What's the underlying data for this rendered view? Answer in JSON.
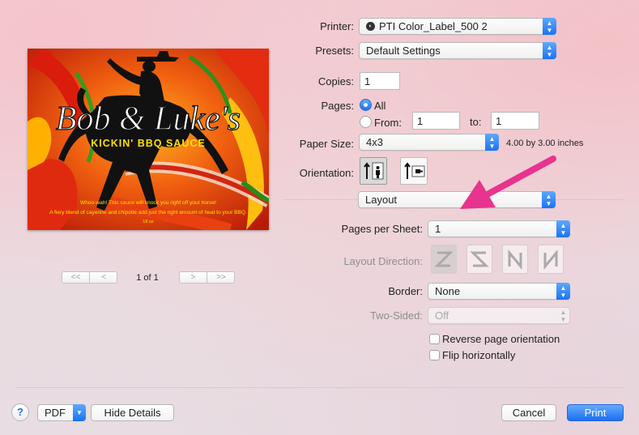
{
  "preview": {
    "title": "Bob & Luke's",
    "subtitle": "KICKIN' BBQ SAUCE",
    "line1": "Whoo-wah! This sauce will knock you right off your horse!",
    "line2": "A fiery blend of cayenne and chipotle add just the right amount of heat to your BBQ.",
    "size": "18 oz"
  },
  "pager": {
    "first": "<<",
    "prev": "<",
    "next": ">",
    "last": ">>",
    "page_label": "1 of 1"
  },
  "printer": {
    "label": "Printer:",
    "value": "PTI Color_Label_500 2"
  },
  "presets": {
    "label": "Presets:",
    "value": "Default Settings"
  },
  "copies": {
    "label": "Copies:",
    "value": "1"
  },
  "pages": {
    "label": "Pages:",
    "all": "All",
    "from_label": "From:",
    "from_value": "1",
    "to_label": "to:",
    "to_value": "1"
  },
  "paper": {
    "label": "Paper Size:",
    "value": "4x3",
    "dims": "4.00 by 3.00 inches"
  },
  "orientation": {
    "label": "Orientation:"
  },
  "section": {
    "value": "Layout"
  },
  "pages_per_sheet": {
    "label": "Pages per Sheet:",
    "value": "1"
  },
  "layout_direction": {
    "label": "Layout Direction:"
  },
  "border": {
    "label": "Border:",
    "value": "None"
  },
  "two_sided": {
    "label": "Two-Sided:",
    "value": "Off"
  },
  "reverse": {
    "label": "Reverse page orientation"
  },
  "flip": {
    "label": "Flip horizontally"
  },
  "footer": {
    "help": "?",
    "pdf": "PDF",
    "hide_details": "Hide Details",
    "cancel": "Cancel",
    "print": "Print"
  },
  "colors": {
    "accent": "#1d6ff0",
    "arrow": "#e8338f"
  }
}
